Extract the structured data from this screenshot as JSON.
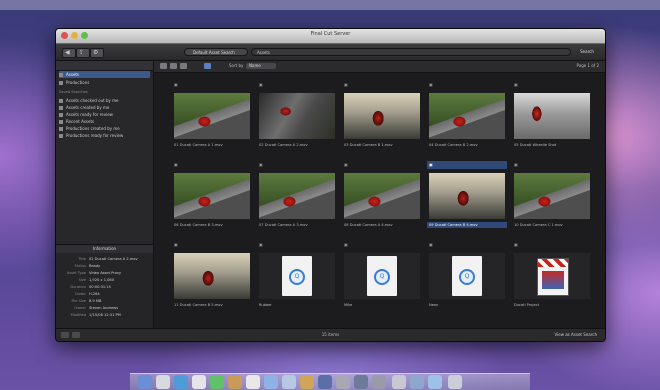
{
  "window": {
    "title": "Final Cut Server"
  },
  "toolbar": {
    "search_scope": "Default Asset Search",
    "search_placeholder": "Assets",
    "search_label": "Search"
  },
  "sidebar": {
    "items": [
      {
        "label": "Assets",
        "selected": true
      },
      {
        "label": "Productions",
        "selected": false
      }
    ],
    "saved_header": "Saved Searches",
    "saved": [
      "Assets checked out by me",
      "Assets created by me",
      "Assets ready for review",
      "Recent Assets",
      "Productions created by me",
      "Productions ready for review"
    ]
  },
  "inspector": {
    "title": "Information",
    "rows": [
      {
        "key": "Title",
        "value": "02 Ducati Camera A 2.mov"
      },
      {
        "key": "Status",
        "value": "Ready"
      },
      {
        "key": "Asset Type",
        "value": "Video Asset Proxy"
      },
      {
        "key": "Size",
        "value": "1,920 x 1,080"
      },
      {
        "key": "Duration",
        "value": "00:00:31:15"
      },
      {
        "key": "Codec",
        "value": "H.264"
      },
      {
        "key": "File Size",
        "value": "8.9 MB"
      },
      {
        "key": "Owner",
        "value": "Steven Andrews"
      },
      {
        "key": "Modified",
        "value": "1/15/08 12:31 PM"
      }
    ]
  },
  "content": {
    "sort_label": "Sort by",
    "sort_value": "Name",
    "page_indicator": "Page 1 of 2",
    "tiles": [
      {
        "label": "01 Ducati Camera A 1.mov",
        "thumb": "road-photo"
      },
      {
        "label": "02 Ducati Camera A 2.mov",
        "thumb": "photo-2"
      },
      {
        "label": "03 Ducati Camera B 1.mov",
        "thumb": "photo-3"
      },
      {
        "label": "04 Ducati Camera B 2.mov",
        "thumb": "road-photo"
      },
      {
        "label": "05 Ducati Wheelie Shot",
        "thumb": "photo-5"
      },
      {
        "label": "06 Ducati Camera B 3.mov",
        "thumb": "road-photo"
      },
      {
        "label": "07 Ducati Camera A 3.mov",
        "thumb": "road-photo"
      },
      {
        "label": "08 Ducati Camera A 4.mov",
        "thumb": "road-photo"
      },
      {
        "label": "09 Ducati Camera B 4.mov",
        "thumb": "photo-3",
        "selected": true
      },
      {
        "label": "10 Ducati Camera C 1.mov",
        "thumb": "road-photo"
      },
      {
        "label": "11 Ducati Camera B 5.mov",
        "thumb": "photo-3"
      },
      {
        "label": "Rubber",
        "thumb": "doc"
      },
      {
        "label": "Mike",
        "thumb": "doc"
      },
      {
        "label": "Neon",
        "thumb": "doc"
      },
      {
        "label": "Ducati Project",
        "thumb": "clapboard"
      }
    ]
  },
  "status": {
    "count": "15 items",
    "right_text": "View as Asset Search"
  }
}
